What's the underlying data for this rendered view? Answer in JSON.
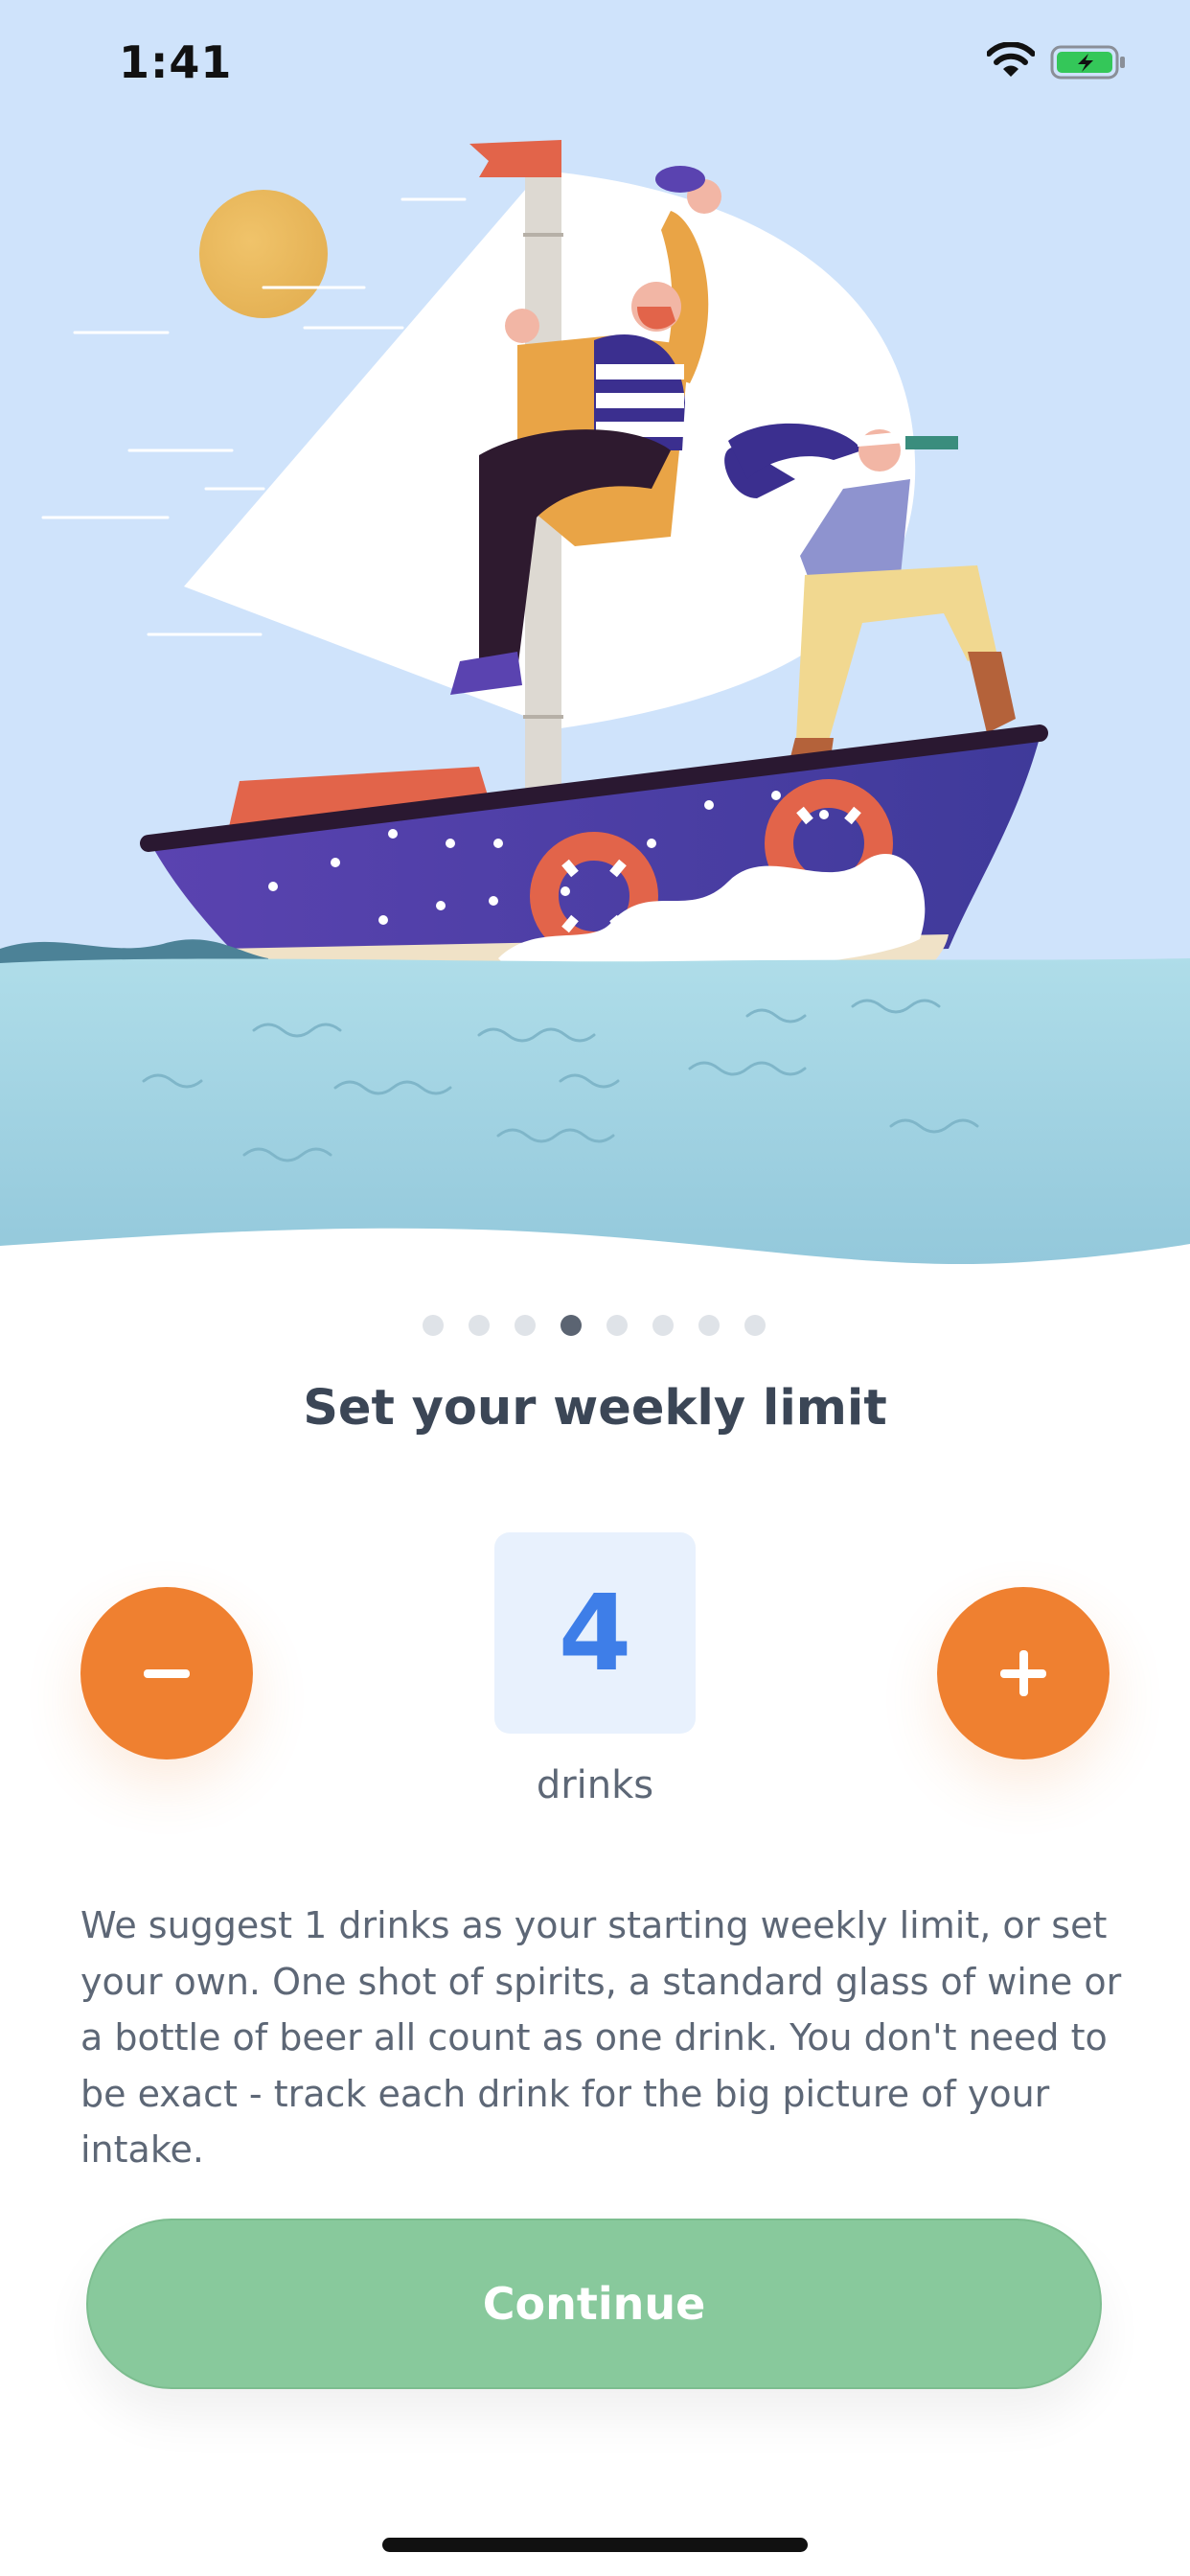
{
  "status_bar": {
    "time": "1:41"
  },
  "pager": {
    "total": 8,
    "active_index": 3
  },
  "title": "Set your weekly limit",
  "counter": {
    "value": "4",
    "unit": "drinks"
  },
  "description": "We suggest 1 drinks as your starting weekly limit, or set your own. One shot of spirits, a standard glass of wine or a bottle of beer all count as one drink. You don't need to be exact - track each drink for the big picture of your intake.",
  "continue_label": "Continue",
  "colors": {
    "accent": "#ef8030",
    "counter_text": "#3e7ee8",
    "counter_bg": "#e8f1fd",
    "continue_bg": "#88c99c",
    "sky": "#cfe3fb",
    "sea": "#a9d8e8"
  }
}
